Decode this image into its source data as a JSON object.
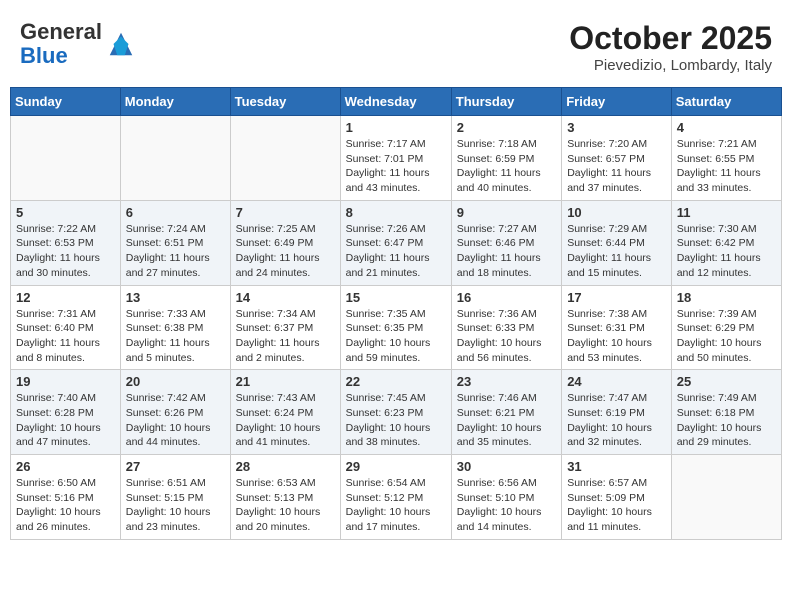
{
  "logo": {
    "general": "General",
    "blue": "Blue"
  },
  "header": {
    "month_year": "October 2025",
    "location": "Pievedizio, Lombardy, Italy"
  },
  "weekdays": [
    "Sunday",
    "Monday",
    "Tuesday",
    "Wednesday",
    "Thursday",
    "Friday",
    "Saturday"
  ],
  "weeks": [
    [
      {
        "day": "",
        "info": ""
      },
      {
        "day": "",
        "info": ""
      },
      {
        "day": "",
        "info": ""
      },
      {
        "day": "1",
        "info": "Sunrise: 7:17 AM\nSunset: 7:01 PM\nDaylight: 11 hours and 43 minutes."
      },
      {
        "day": "2",
        "info": "Sunrise: 7:18 AM\nSunset: 6:59 PM\nDaylight: 11 hours and 40 minutes."
      },
      {
        "day": "3",
        "info": "Sunrise: 7:20 AM\nSunset: 6:57 PM\nDaylight: 11 hours and 37 minutes."
      },
      {
        "day": "4",
        "info": "Sunrise: 7:21 AM\nSunset: 6:55 PM\nDaylight: 11 hours and 33 minutes."
      }
    ],
    [
      {
        "day": "5",
        "info": "Sunrise: 7:22 AM\nSunset: 6:53 PM\nDaylight: 11 hours and 30 minutes."
      },
      {
        "day": "6",
        "info": "Sunrise: 7:24 AM\nSunset: 6:51 PM\nDaylight: 11 hours and 27 minutes."
      },
      {
        "day": "7",
        "info": "Sunrise: 7:25 AM\nSunset: 6:49 PM\nDaylight: 11 hours and 24 minutes."
      },
      {
        "day": "8",
        "info": "Sunrise: 7:26 AM\nSunset: 6:47 PM\nDaylight: 11 hours and 21 minutes."
      },
      {
        "day": "9",
        "info": "Sunrise: 7:27 AM\nSunset: 6:46 PM\nDaylight: 11 hours and 18 minutes."
      },
      {
        "day": "10",
        "info": "Sunrise: 7:29 AM\nSunset: 6:44 PM\nDaylight: 11 hours and 15 minutes."
      },
      {
        "day": "11",
        "info": "Sunrise: 7:30 AM\nSunset: 6:42 PM\nDaylight: 11 hours and 12 minutes."
      }
    ],
    [
      {
        "day": "12",
        "info": "Sunrise: 7:31 AM\nSunset: 6:40 PM\nDaylight: 11 hours and 8 minutes."
      },
      {
        "day": "13",
        "info": "Sunrise: 7:33 AM\nSunset: 6:38 PM\nDaylight: 11 hours and 5 minutes."
      },
      {
        "day": "14",
        "info": "Sunrise: 7:34 AM\nSunset: 6:37 PM\nDaylight: 11 hours and 2 minutes."
      },
      {
        "day": "15",
        "info": "Sunrise: 7:35 AM\nSunset: 6:35 PM\nDaylight: 10 hours and 59 minutes."
      },
      {
        "day": "16",
        "info": "Sunrise: 7:36 AM\nSunset: 6:33 PM\nDaylight: 10 hours and 56 minutes."
      },
      {
        "day": "17",
        "info": "Sunrise: 7:38 AM\nSunset: 6:31 PM\nDaylight: 10 hours and 53 minutes."
      },
      {
        "day": "18",
        "info": "Sunrise: 7:39 AM\nSunset: 6:29 PM\nDaylight: 10 hours and 50 minutes."
      }
    ],
    [
      {
        "day": "19",
        "info": "Sunrise: 7:40 AM\nSunset: 6:28 PM\nDaylight: 10 hours and 47 minutes."
      },
      {
        "day": "20",
        "info": "Sunrise: 7:42 AM\nSunset: 6:26 PM\nDaylight: 10 hours and 44 minutes."
      },
      {
        "day": "21",
        "info": "Sunrise: 7:43 AM\nSunset: 6:24 PM\nDaylight: 10 hours and 41 minutes."
      },
      {
        "day": "22",
        "info": "Sunrise: 7:45 AM\nSunset: 6:23 PM\nDaylight: 10 hours and 38 minutes."
      },
      {
        "day": "23",
        "info": "Sunrise: 7:46 AM\nSunset: 6:21 PM\nDaylight: 10 hours and 35 minutes."
      },
      {
        "day": "24",
        "info": "Sunrise: 7:47 AM\nSunset: 6:19 PM\nDaylight: 10 hours and 32 minutes."
      },
      {
        "day": "25",
        "info": "Sunrise: 7:49 AM\nSunset: 6:18 PM\nDaylight: 10 hours and 29 minutes."
      }
    ],
    [
      {
        "day": "26",
        "info": "Sunrise: 6:50 AM\nSunset: 5:16 PM\nDaylight: 10 hours and 26 minutes."
      },
      {
        "day": "27",
        "info": "Sunrise: 6:51 AM\nSunset: 5:15 PM\nDaylight: 10 hours and 23 minutes."
      },
      {
        "day": "28",
        "info": "Sunrise: 6:53 AM\nSunset: 5:13 PM\nDaylight: 10 hours and 20 minutes."
      },
      {
        "day": "29",
        "info": "Sunrise: 6:54 AM\nSunset: 5:12 PM\nDaylight: 10 hours and 17 minutes."
      },
      {
        "day": "30",
        "info": "Sunrise: 6:56 AM\nSunset: 5:10 PM\nDaylight: 10 hours and 14 minutes."
      },
      {
        "day": "31",
        "info": "Sunrise: 6:57 AM\nSunset: 5:09 PM\nDaylight: 10 hours and 11 minutes."
      },
      {
        "day": "",
        "info": ""
      }
    ]
  ]
}
